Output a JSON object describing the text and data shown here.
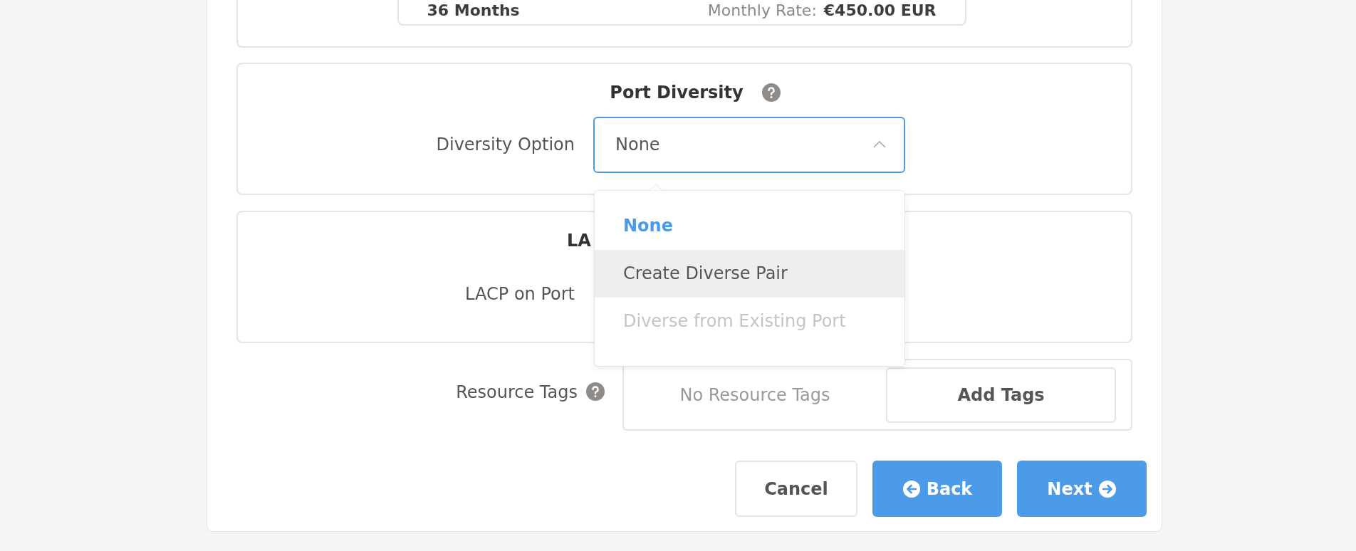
{
  "plan_summary": {
    "term": "36 Months",
    "rate_label": "Monthly Rate:",
    "rate_value": "€450.00 EUR"
  },
  "port_diversity": {
    "title": "Port Diversity",
    "field_label": "Diversity Option",
    "value": "None",
    "expanded": true,
    "options": [
      {
        "label": "None",
        "selected": true,
        "hovered": false,
        "disabled": false
      },
      {
        "label": "Create Diverse Pair",
        "selected": false,
        "hovered": true,
        "disabled": false
      },
      {
        "label": "Diverse from Existing Port",
        "selected": false,
        "hovered": false,
        "disabled": true
      }
    ]
  },
  "lacp": {
    "title": "LA",
    "field_label": "LACP on Port"
  },
  "resource_tags": {
    "label": "Resource Tags",
    "empty_text": "No Resource Tags",
    "add_button": "Add Tags"
  },
  "buttons": [
    {
      "label": "Cancel",
      "kind": "secondary"
    },
    {
      "label": "Back",
      "kind": "back"
    },
    {
      "label": "Next",
      "kind": "next"
    }
  ]
}
